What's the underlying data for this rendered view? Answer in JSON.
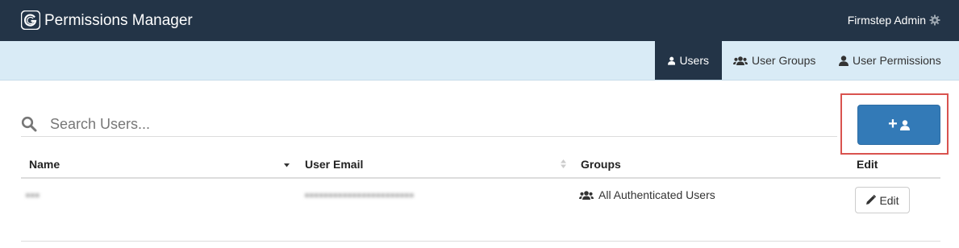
{
  "header": {
    "app_title": "Permissions Manager",
    "user_name": "Firmstep Admin",
    "logo_icon": "firmstep-logo-icon",
    "settings_icon": "gear-icon"
  },
  "nav": {
    "tabs": [
      {
        "label": "Users",
        "icon": "user-icon",
        "active": true
      },
      {
        "label": "User Groups",
        "icon": "users-icon",
        "active": false
      },
      {
        "label": "User Permissions",
        "icon": "user-icon",
        "active": false
      }
    ]
  },
  "search": {
    "placeholder": "Search Users...",
    "value": ""
  },
  "add_user_button": {
    "label": "+",
    "icon": "user-icon"
  },
  "table": {
    "columns": [
      "Name",
      "User Email",
      "Groups",
      "Edit"
    ],
    "sort": {
      "Name": "descending",
      "User Email": "unsorted"
    },
    "rows": [
      {
        "name": "•••",
        "email": "•••••••••••••••••••••••",
        "group": "All Authenticated Users",
        "edit_label": "Edit"
      }
    ]
  },
  "colors": {
    "topbar": "#233447",
    "navbar": "#d9ebf6",
    "primary": "#337ab7",
    "highlight": "#d9534f"
  }
}
